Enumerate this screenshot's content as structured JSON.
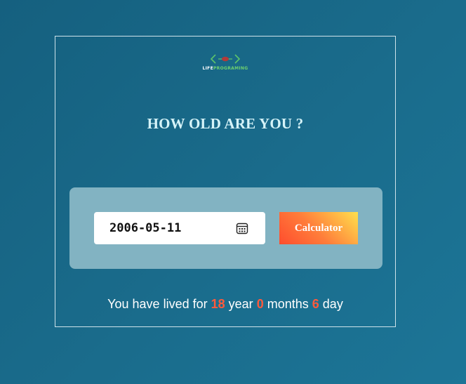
{
  "logo": {
    "brand_part1": "LIFE",
    "brand_part2": "PROGRAMING",
    "tagline": "·"
  },
  "title": "HOW OLD ARE YOU ?",
  "form": {
    "date_value": "2006-05-11",
    "calc_label": "Calculator"
  },
  "result": {
    "prefix": "You have lived for",
    "years": "18",
    "years_label": "year",
    "months": "0",
    "months_label": "months",
    "days": "6",
    "days_label": "day"
  },
  "colors": {
    "accent_number": "#ff5a3c",
    "button_gradient_start": "#ff4d2e",
    "button_gradient_end": "#ffe04d",
    "panel": "#82b3c2",
    "title": "#d5f3f8"
  },
  "icons": {
    "calendar": "calendar-icon",
    "logo": "code-brackets-logo"
  }
}
